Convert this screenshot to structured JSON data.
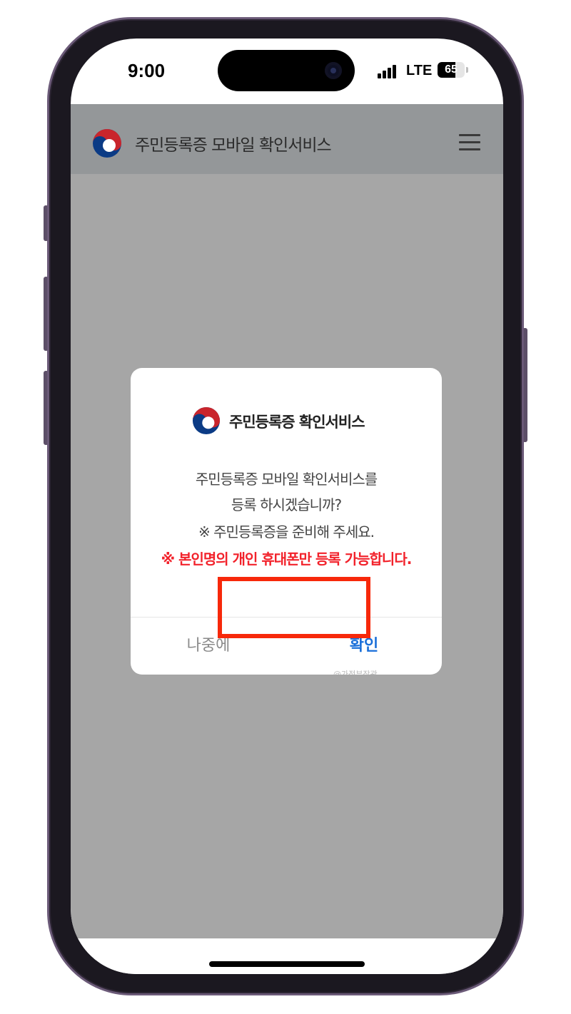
{
  "status_bar": {
    "time": "9:00",
    "network": "LTE",
    "battery_percent": "65",
    "battery_level": 0.65,
    "signal_bars": 4
  },
  "header": {
    "title": "주민등록증 모바일 확인서비스",
    "logo_icon": "government-emblem-icon",
    "menu_icon": "hamburger-menu-icon"
  },
  "dialog": {
    "title": "주민등록증 확인서비스",
    "logo_icon": "government-emblem-icon",
    "message_line_1": "주민등록증 모바일 확인서비스를",
    "message_line_2": "등록 하시겠습니까?",
    "message_line_3": "※ 주민등록증을 준비해 주세요.",
    "warning": "※ 본인명의 개인 휴대폰만 등록 가능합니다.",
    "later_label": "나중에",
    "confirm_label": "확인",
    "watermark": "@가정부장관"
  },
  "colors": {
    "overlay_background": "#a6a6a6",
    "header_background": "#949799",
    "warning_text": "#f2222b",
    "confirm_text": "#1a6fd9",
    "highlight_border": "#f7280a",
    "emblem_red": "#c9252c",
    "emblem_blue": "#0b3b85"
  }
}
